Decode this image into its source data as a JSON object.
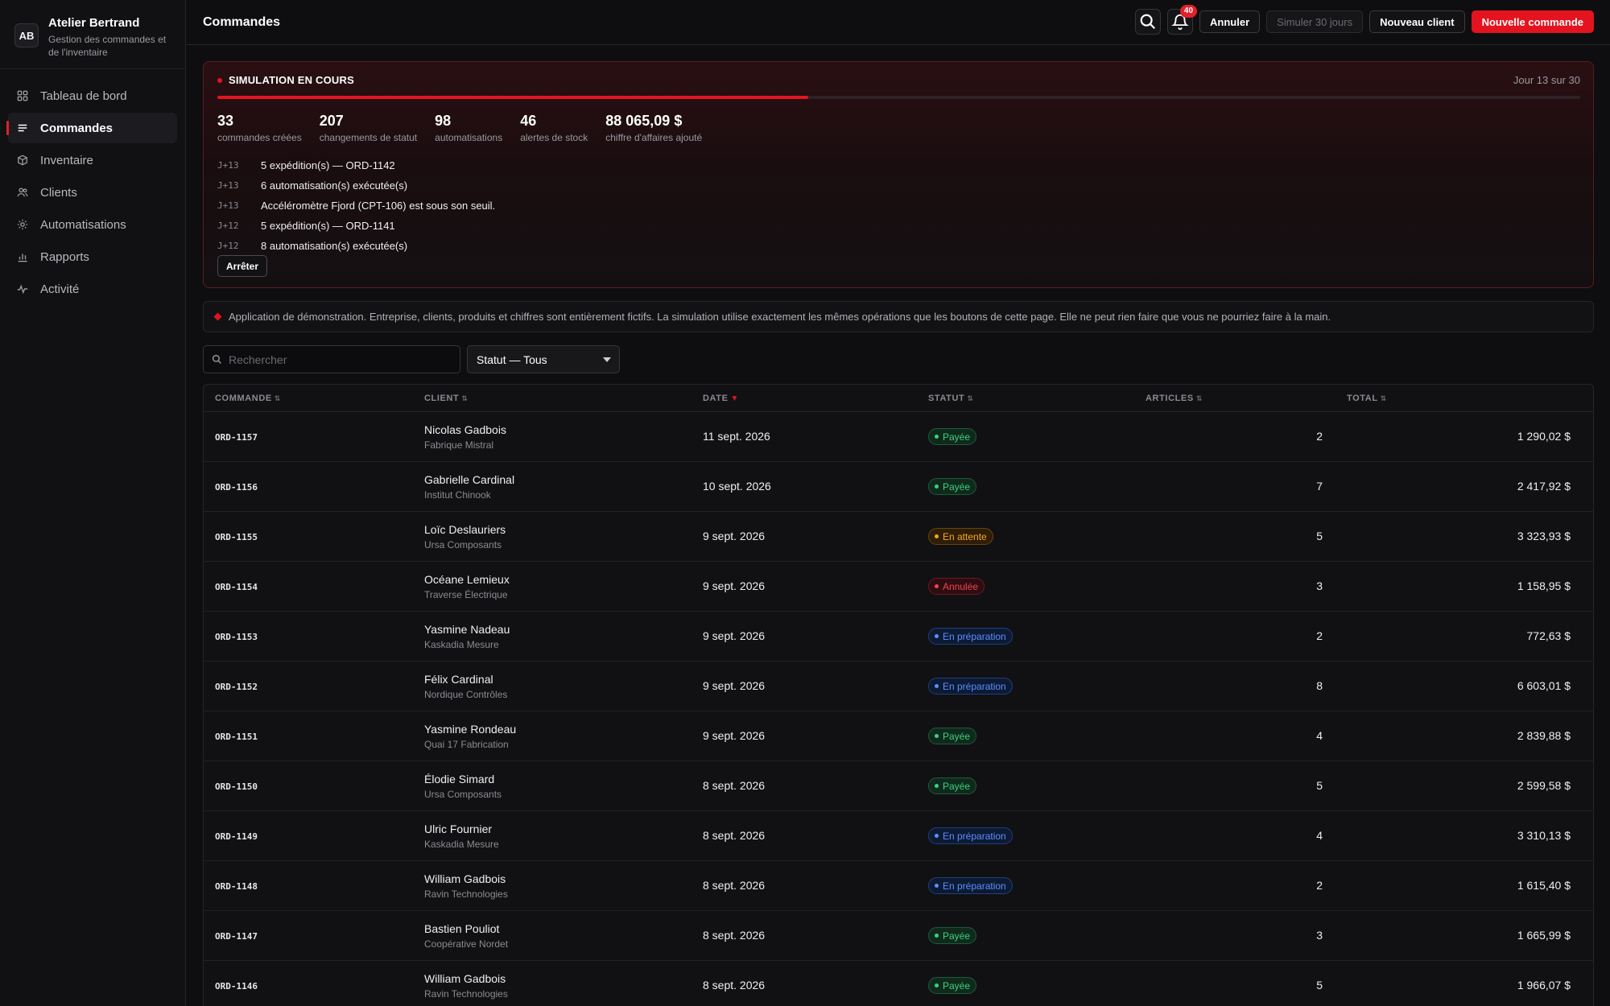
{
  "brand": {
    "initials": "AB",
    "name": "Atelier Bertrand",
    "subtitle": "Gestion des commandes et de l'inventaire"
  },
  "nav": [
    {
      "label": "Tableau de bord",
      "icon": "dashboard-icon",
      "active": false
    },
    {
      "label": "Commandes",
      "icon": "list-icon",
      "active": true
    },
    {
      "label": "Inventaire",
      "icon": "box-icon",
      "active": false
    },
    {
      "label": "Clients",
      "icon": "users-icon",
      "active": false
    },
    {
      "label": "Automatisations",
      "icon": "gear-icon",
      "active": false
    },
    {
      "label": "Rapports",
      "icon": "bar-chart-icon",
      "active": false
    },
    {
      "label": "Activité",
      "icon": "activity-icon",
      "active": false
    }
  ],
  "header": {
    "title": "Commandes",
    "notifications_count": "40",
    "cancel_label": "Annuler",
    "simulate_label": "Simuler 30 jours",
    "new_client_label": "Nouveau client",
    "new_order_label": "Nouvelle commande"
  },
  "simulation": {
    "title": "SIMULATION EN COURS",
    "day_label": "Jour 13 sur 30",
    "progress": 0.4333,
    "stats": [
      {
        "value": "33",
        "label": "commandes créées"
      },
      {
        "value": "207",
        "label": "changements de statut"
      },
      {
        "value": "98",
        "label": "automatisations"
      },
      {
        "value": "46",
        "label": "alertes de stock"
      },
      {
        "value": "88 065,09 $",
        "label": "chiffre d'affaires ajouté"
      }
    ],
    "log": [
      {
        "day": "J+13",
        "text": "5 expédition(s) — ORD-1142"
      },
      {
        "day": "J+13",
        "text": "6 automatisation(s) exécutée(s)"
      },
      {
        "day": "J+13",
        "text": "Accéléromètre Fjord (CPT-106) est sous son seuil."
      },
      {
        "day": "J+12",
        "text": "5 expédition(s) — ORD-1141"
      },
      {
        "day": "J+12",
        "text": "8 automatisation(s) exécutée(s)"
      }
    ],
    "stop_label": "Arrêter"
  },
  "notice": {
    "text": "Application de démonstration. Entreprise, clients, produits et chiffres sont entièrement fictifs. La simulation utilise exactement les mêmes opérations que les boutons de cette page. Elle ne peut rien faire que vous ne pourriez faire à la main."
  },
  "filters": {
    "search_placeholder": "Rechercher",
    "search_value": "",
    "status_value": "Statut — Tous"
  },
  "table": {
    "columns": [
      "COMMANDE",
      "CLIENT",
      "DATE",
      "STATUT",
      "ARTICLES",
      "TOTAL"
    ],
    "rows": [
      {
        "id": "ORD-1157",
        "client": "Nicolas Gadbois",
        "company": "Fabrique Mistral",
        "date": "11 sept. 2026",
        "status": "Payée",
        "status_type": "paid",
        "items": "2",
        "total": "1 290,02 $"
      },
      {
        "id": "ORD-1156",
        "client": "Gabrielle Cardinal",
        "company": "Institut Chinook",
        "date": "10 sept. 2026",
        "status": "Payée",
        "status_type": "paid",
        "items": "7",
        "total": "2 417,92 $"
      },
      {
        "id": "ORD-1155",
        "client": "Loïc Deslauriers",
        "company": "Ursa Composants",
        "date": "9 sept. 2026",
        "status": "En attente",
        "status_type": "pending",
        "items": "5",
        "total": "3 323,93 $"
      },
      {
        "id": "ORD-1154",
        "client": "Océane Lemieux",
        "company": "Traverse Électrique",
        "date": "9 sept. 2026",
        "status": "Annulée",
        "status_type": "cancel",
        "items": "3",
        "total": "1 158,95 $"
      },
      {
        "id": "ORD-1153",
        "client": "Yasmine Nadeau",
        "company": "Kaskadia Mesure",
        "date": "9 sept. 2026",
        "status": "En préparation",
        "status_type": "prep",
        "items": "2",
        "total": "772,63 $"
      },
      {
        "id": "ORD-1152",
        "client": "Félix Cardinal",
        "company": "Nordique Contrôles",
        "date": "9 sept. 2026",
        "status": "En préparation",
        "status_type": "prep",
        "items": "8",
        "total": "6 603,01 $"
      },
      {
        "id": "ORD-1151",
        "client": "Yasmine Rondeau",
        "company": "Quai 17 Fabrication",
        "date": "9 sept. 2026",
        "status": "Payée",
        "status_type": "paid",
        "items": "4",
        "total": "2 839,88 $"
      },
      {
        "id": "ORD-1150",
        "client": "Élodie Simard",
        "company": "Ursa Composants",
        "date": "8 sept. 2026",
        "status": "Payée",
        "status_type": "paid",
        "items": "5",
        "total": "2 599,58 $"
      },
      {
        "id": "ORD-1149",
        "client": "Ulric Fournier",
        "company": "Kaskadia Mesure",
        "date": "8 sept. 2026",
        "status": "En préparation",
        "status_type": "prep",
        "items": "4",
        "total": "3 310,13 $"
      },
      {
        "id": "ORD-1148",
        "client": "William Gadbois",
        "company": "Ravin Technologies",
        "date": "8 sept. 2026",
        "status": "En préparation",
        "status_type": "prep",
        "items": "2",
        "total": "1 615,40 $"
      },
      {
        "id": "ORD-1147",
        "client": "Bastien Pouliot",
        "company": "Coopérative Nordet",
        "date": "8 sept. 2026",
        "status": "Payée",
        "status_type": "paid",
        "items": "3",
        "total": "1 665,99 $"
      },
      {
        "id": "ORD-1146",
        "client": "William Gadbois",
        "company": "Ravin Technologies",
        "date": "8 sept. 2026",
        "status": "Payée",
        "status_type": "paid",
        "items": "5",
        "total": "1 966,07 $"
      }
    ]
  },
  "colors": {
    "accent": "#e3141f",
    "paid": "#3ecf7e",
    "pending": "#f5a524",
    "cancel": "#f0454e",
    "prep": "#5b8fff"
  }
}
